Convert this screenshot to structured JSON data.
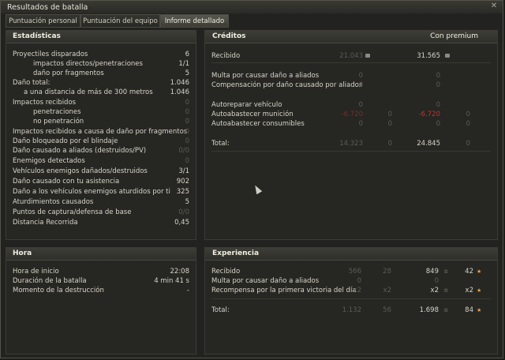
{
  "window": {
    "title": "Resultados de batalla",
    "close": "✕"
  },
  "tabs": [
    {
      "label": "Puntuación personal"
    },
    {
      "label": "Puntuación del equipo"
    },
    {
      "label": "Informe detallado"
    }
  ],
  "stats": {
    "header": "Estadísticas",
    "rows": [
      {
        "label": "Proyectiles disparados",
        "value": "6"
      },
      {
        "label": "impactos directos/penetraciones",
        "value": "1/1"
      },
      {
        "label": "daño por fragmentos",
        "value": "5"
      },
      {
        "label": "Daño total:",
        "value": "1.046"
      },
      {
        "label": "a una distancia de más de 300 metros",
        "value": "1.046"
      },
      {
        "label": "Impactos recibidos",
        "value": "0"
      },
      {
        "label": "penetraciones",
        "value": "0"
      },
      {
        "label": "no penetración",
        "value": "0"
      },
      {
        "label": "Impactos recibidos a causa de daño por fragmentos",
        "value": "0"
      },
      {
        "label": "Daño bloqueado por el blindaje",
        "value": "0"
      },
      {
        "label": "Daño causado a aliados (destruidos/PV)",
        "value": "0/0"
      },
      {
        "label": "Enemigos detectados",
        "value": "0"
      },
      {
        "label": "Vehículos enemigos dañados/destruidos",
        "value": "3/1"
      },
      {
        "label": "Daño causado con tu asistencia",
        "value": "902"
      },
      {
        "label": "Daño a los vehículos enemigos aturdidos por ti",
        "value": "325"
      },
      {
        "label": "Aturdimientos causados",
        "value": "5"
      },
      {
        "label": "Puntos de captura/defensa de base",
        "value": "0/0"
      },
      {
        "label": "Distancia Recorrida",
        "value": "0,45"
      }
    ]
  },
  "time": {
    "header": "Hora",
    "rows": [
      {
        "label": "Hora de inicio",
        "value": "22:08"
      },
      {
        "label": "Duración de la batalla",
        "value": "4 min 41 s"
      },
      {
        "label": "Momento de la destrucción",
        "value": "-"
      }
    ]
  },
  "credits": {
    "header": "Créditos",
    "premium_label": "Con premium",
    "rows": [
      {
        "label": "Recibido",
        "base": "21.043",
        "premium": "31.565"
      },
      {
        "label": "Multa por causar daño a aliados",
        "base": "0",
        "premium": "0"
      },
      {
        "label": "Compensación por daño causado por aliados",
        "base": "0",
        "premium": "0"
      },
      {
        "label": "Autoreparar vehículo",
        "base": "0",
        "premium": "0"
      },
      {
        "label": "Autoabastecer munición",
        "base": "-6.720",
        "base_gold": "0",
        "premium": "-6.720",
        "premium_gold": "0"
      },
      {
        "label": "Autoabastecer consumibles",
        "base": "0",
        "base_gold": "0",
        "premium": "0",
        "premium_gold": "0"
      },
      {
        "label": "Total:",
        "base": "14.323",
        "base_gold": "0",
        "premium": "24.845",
        "premium_gold": "0"
      }
    ]
  },
  "experience": {
    "header": "Experiencia",
    "rows": [
      {
        "label": "Recibido",
        "base": "566",
        "base_free": "28",
        "premium": "849",
        "premium_free": "42"
      },
      {
        "label": "Multa por causar daño a aliados",
        "base": "0",
        "premium": "0"
      },
      {
        "label": "Recompensa por la primera victoria del día",
        "base": "x2",
        "base_free": "x2",
        "premium": "x2",
        "premium_free": "x2"
      },
      {
        "label": "Total:",
        "base": "1.132",
        "base_free": "56",
        "premium": "1.698",
        "premium_free": "84"
      }
    ]
  },
  "colors": {
    "accent": "#e8a046",
    "negative": "#c4322a",
    "dim": "#5c5b52"
  }
}
